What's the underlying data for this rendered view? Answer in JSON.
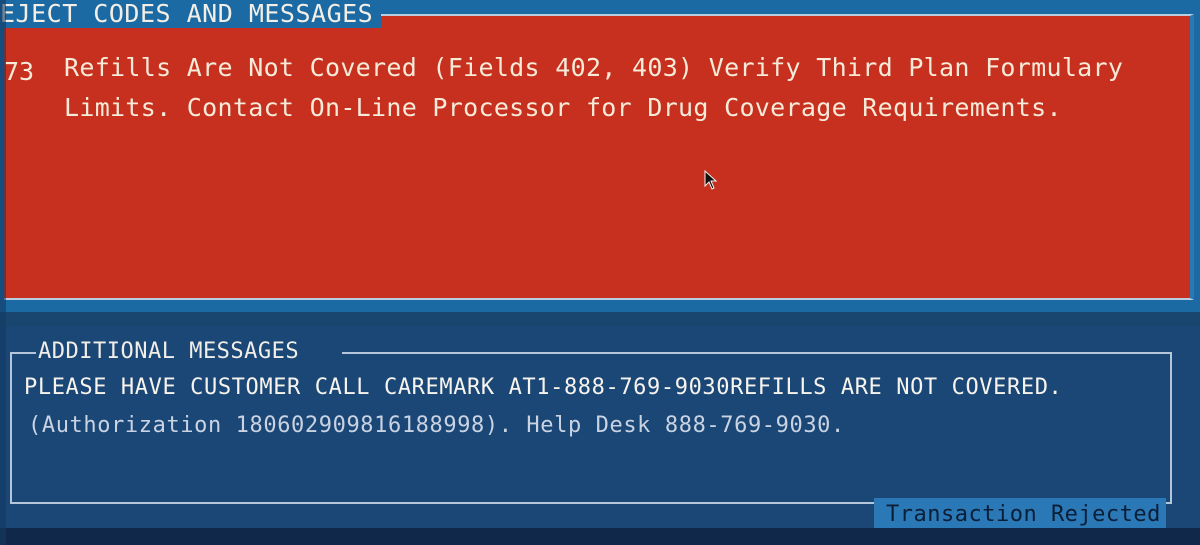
{
  "reject_panel": {
    "legend": "EJECT CODES AND MESSAGES",
    "code": "73",
    "message": "Refills Are Not Covered (Fields 402, 403) Verify Third Plan Formulary Limits. Contact On-Line Processor for Drug Coverage Requirements."
  },
  "additional_panel": {
    "legend": "ADDITIONAL MESSAGES",
    "line1": "PLEASE HAVE CUSTOMER CALL CAREMARK AT1-888-769-9030REFILLS ARE NOT COVERED.",
    "line2": "(Authorization 180602909816188998). Help Desk 888-769-9030."
  },
  "status": {
    "label": "Transaction Rejected"
  },
  "colors": {
    "reject_background": "#c7301f",
    "panel_blue": "#1c6aa3",
    "additional_background": "#1b4777",
    "status_bar": "#2b78b6"
  },
  "icons": {
    "cursor": "mouse-pointer-icon"
  }
}
